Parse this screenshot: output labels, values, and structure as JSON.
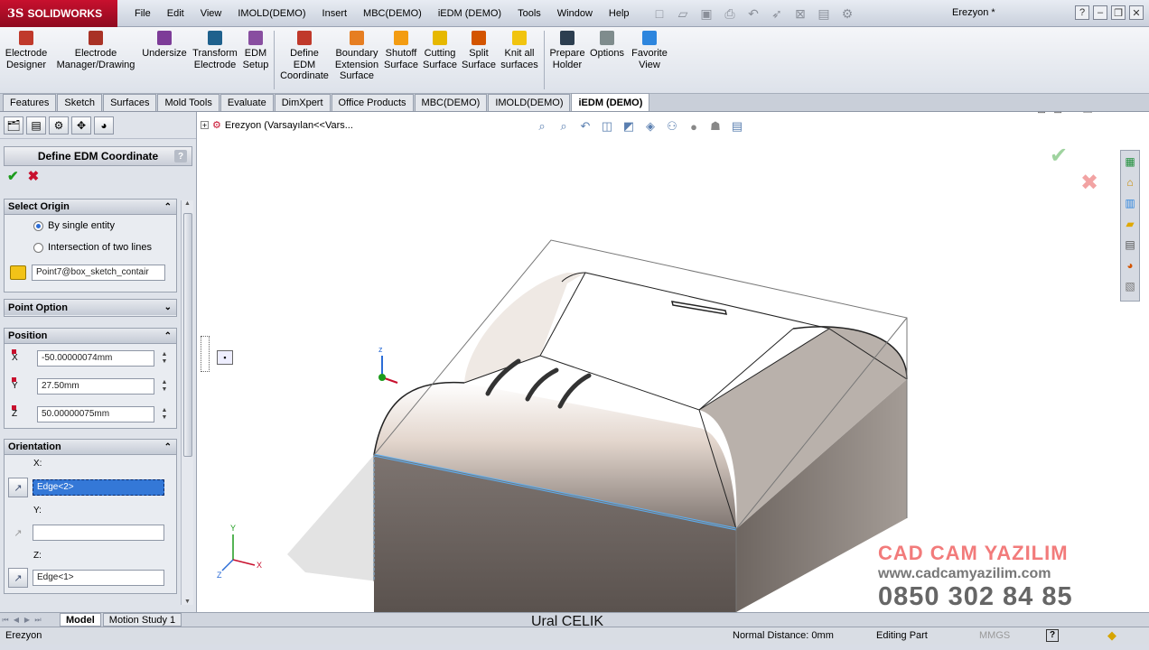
{
  "app": {
    "brand_prefix": "3S",
    "brand": "SOLIDWORKS",
    "document_title": "Erezyon *"
  },
  "menu": [
    "File",
    "Edit",
    "View",
    "IMOLD(DEMO)",
    "Insert",
    "MBC(DEMO)",
    "iEDM (DEMO)",
    "Tools",
    "Window",
    "Help"
  ],
  "ribbon": [
    {
      "label": "Electrode Designer",
      "icon": "electrode-designer-icon",
      "color": "#c0392b"
    },
    {
      "label": "Electrode Manager/Drawing",
      "icon": "electrode-manager-icon",
      "color": "#a93226"
    },
    {
      "label": "Undersize",
      "icon": "undersize-icon",
      "color": "#7d3c98"
    },
    {
      "label": "Transform Electrode",
      "icon": "transform-electrode-icon",
      "color": "#1f618d"
    },
    {
      "label": "EDM Setup",
      "icon": "edm-setup-icon",
      "color": "#884ea0"
    },
    {
      "label": "Define EDM Coordinate",
      "icon": "define-edm-coordinate-icon",
      "color": "#c0392b"
    },
    {
      "label": "Boundary Extension Surface",
      "icon": "boundary-extension-icon",
      "color": "#e67e22"
    },
    {
      "label": "Shutoff Surface",
      "icon": "shutoff-surface-icon",
      "color": "#f39c12"
    },
    {
      "label": "Cutting Surface",
      "icon": "cutting-surface-icon",
      "color": "#e6b800"
    },
    {
      "label": "Split Surface",
      "icon": "split-surface-icon",
      "color": "#d35400"
    },
    {
      "label": "Knit all surfaces",
      "icon": "knit-surfaces-icon",
      "color": "#f1c40f"
    },
    {
      "label": "Prepare Holder",
      "icon": "prepare-holder-icon",
      "color": "#2c3e50"
    },
    {
      "label": "Options",
      "icon": "options-icon",
      "color": "#7f8c8d"
    },
    {
      "label": "Favorite View",
      "icon": "favorite-view-icon",
      "color": "#2e86de"
    }
  ],
  "tabs": [
    "Features",
    "Sketch",
    "Surfaces",
    "Mold Tools",
    "Evaluate",
    "DimXpert",
    "Office Products",
    "MBC(DEMO)",
    "IMOLD(DEMO)",
    "iEDM (DEMO)"
  ],
  "active_tab": "iEDM (DEMO)",
  "property_manager": {
    "title": "Define EDM Coordinate",
    "help": "?",
    "ok": "✔",
    "cancel": "✖",
    "select_origin": {
      "header": "Select Origin",
      "option1": "By single entity",
      "option2": "Intersection of two lines",
      "selected": 1,
      "entity": "Point7@box_sketch_contair"
    },
    "point_option": {
      "header": "Point Option"
    },
    "position": {
      "header": "Position",
      "x_label": "X",
      "y_label": "Y",
      "z_label": "Z",
      "x": "-50.00000074mm",
      "y": "27.50mm",
      "z": "50.00000075mm"
    },
    "orientation": {
      "header": "Orientation",
      "x_label": "X:",
      "y_label": "Y:",
      "z_label": "Z:",
      "x": "Edge<2>",
      "y": "",
      "z": "Edge<1>"
    }
  },
  "feature_tree": {
    "label": "Erezyon  (Varsayılan<<Vars..."
  },
  "bottom_tabs": [
    "Model",
    "Motion Study 1"
  ],
  "status": {
    "left": "Erezyon",
    "normal_distance": "Normal Distance: 0mm",
    "mode": "Editing Part",
    "units": "MMGS"
  },
  "watermark": {
    "line1": "CAD CAM YAZILIM",
    "line2": "www.cadcamyazilim.com",
    "line3": "0850 302 84 85"
  },
  "author_caption": "Ural CELIK",
  "colors": {
    "accent_red": "#c8102e",
    "selection_blue": "#3478d7",
    "ok_green": "#1c9b1c"
  }
}
